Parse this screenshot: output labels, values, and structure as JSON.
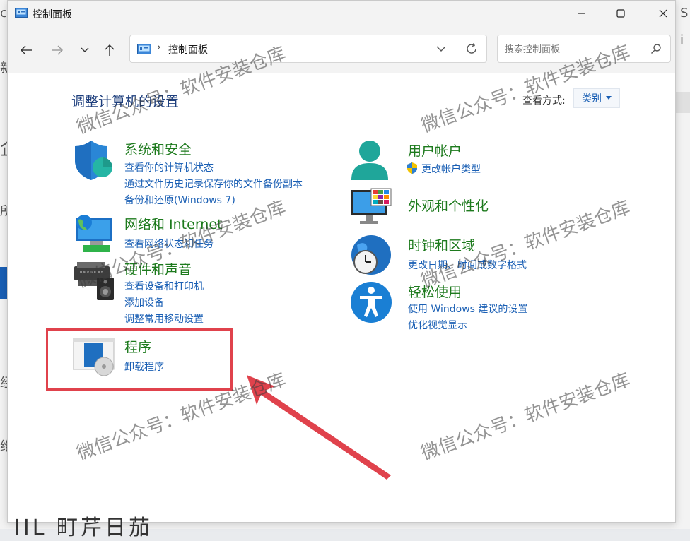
{
  "window": {
    "title": "控制面板",
    "controls": {
      "minimize": "minimize",
      "maximize": "maximize",
      "close": "close"
    }
  },
  "nav": {
    "breadcrumb": "控制面板",
    "search_placeholder": "搜索控制面板"
  },
  "main": {
    "heading": "调整计算机的设置",
    "view_by_label": "查看方式:",
    "view_by_value": "类别"
  },
  "categories": {
    "system": {
      "title": "系统和安全",
      "links": [
        "查看你的计算机状态",
        "通过文件历史记录保存你的文件备份副本",
        "备份和还原(Windows 7)"
      ]
    },
    "network": {
      "title": "网络和 Internet",
      "links": [
        "查看网络状态和任务"
      ]
    },
    "hardware": {
      "title": "硬件和声音",
      "links": [
        "查看设备和打印机",
        "添加设备",
        "调整常用移动设置"
      ]
    },
    "programs": {
      "title": "程序",
      "links": [
        "卸载程序"
      ]
    },
    "user": {
      "title": "用户帐户",
      "links": [
        "更改帐户类型"
      ]
    },
    "appearance": {
      "title": "外观和个性化",
      "links": []
    },
    "clock": {
      "title": "时钟和区域",
      "links": [
        "更改日期、时间或数字格式"
      ]
    },
    "ease": {
      "title": "轻松使用",
      "links": [
        "使用 Windows 建议的设置",
        "优化视觉显示"
      ]
    }
  },
  "watermark": "微信公众号：软件安装仓库",
  "colors": {
    "category_title": "#1d7a1d",
    "link": "#1a5fb4",
    "heading": "#1e3f7d",
    "highlight": "#e0424c"
  }
}
